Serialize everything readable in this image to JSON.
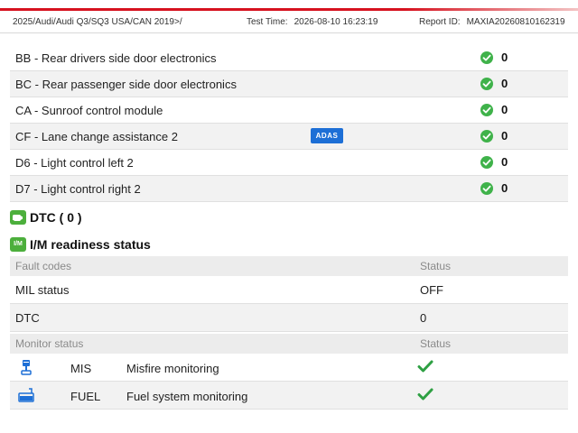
{
  "header": {
    "path": "2025/Audi/Audi Q3/SQ3 USA/CAN 2019>/",
    "test_time_label": "Test Time:",
    "test_time": "2026-08-10 16:23:19",
    "report_id_label": "Report ID:",
    "report_id": "MAXIA20260810162319"
  },
  "modules": [
    {
      "name": "BB - Rear drivers side door electronics",
      "value": "0",
      "badge": ""
    },
    {
      "name": "BC - Rear passenger side door electronics",
      "value": "0",
      "badge": ""
    },
    {
      "name": "CA - Sunroof control module",
      "value": "0",
      "badge": ""
    },
    {
      "name": "CF - Lane change assistance 2",
      "value": "0",
      "badge": "ADAS"
    },
    {
      "name": "D6 - Light control left 2",
      "value": "0",
      "badge": ""
    },
    {
      "name": "D7 - Light control right 2",
      "value": "0",
      "badge": ""
    }
  ],
  "dtc_section": {
    "title": "DTC ( 0 )"
  },
  "im_section": {
    "title": "I/M readiness status",
    "badge": "I/M"
  },
  "fault_table": {
    "col1": "Fault codes",
    "col2": "Status",
    "rows": [
      {
        "name": "MIL status",
        "status": "OFF"
      },
      {
        "name": "DTC",
        "status": "0"
      }
    ]
  },
  "monitor_table": {
    "col1": "Monitor status",
    "col2": "Status",
    "rows": [
      {
        "icon": "misfire-piston-icon",
        "abbr": "MIS",
        "name": "Misfire monitoring"
      },
      {
        "icon": "fuel-system-icon",
        "abbr": "FUEL",
        "name": "Fuel system monitoring"
      }
    ]
  },
  "colors": {
    "accent": "#d6121f",
    "ok": "#3fb24a",
    "adas": "#1d6fd6",
    "icon_blue": "#1d6fd6"
  }
}
